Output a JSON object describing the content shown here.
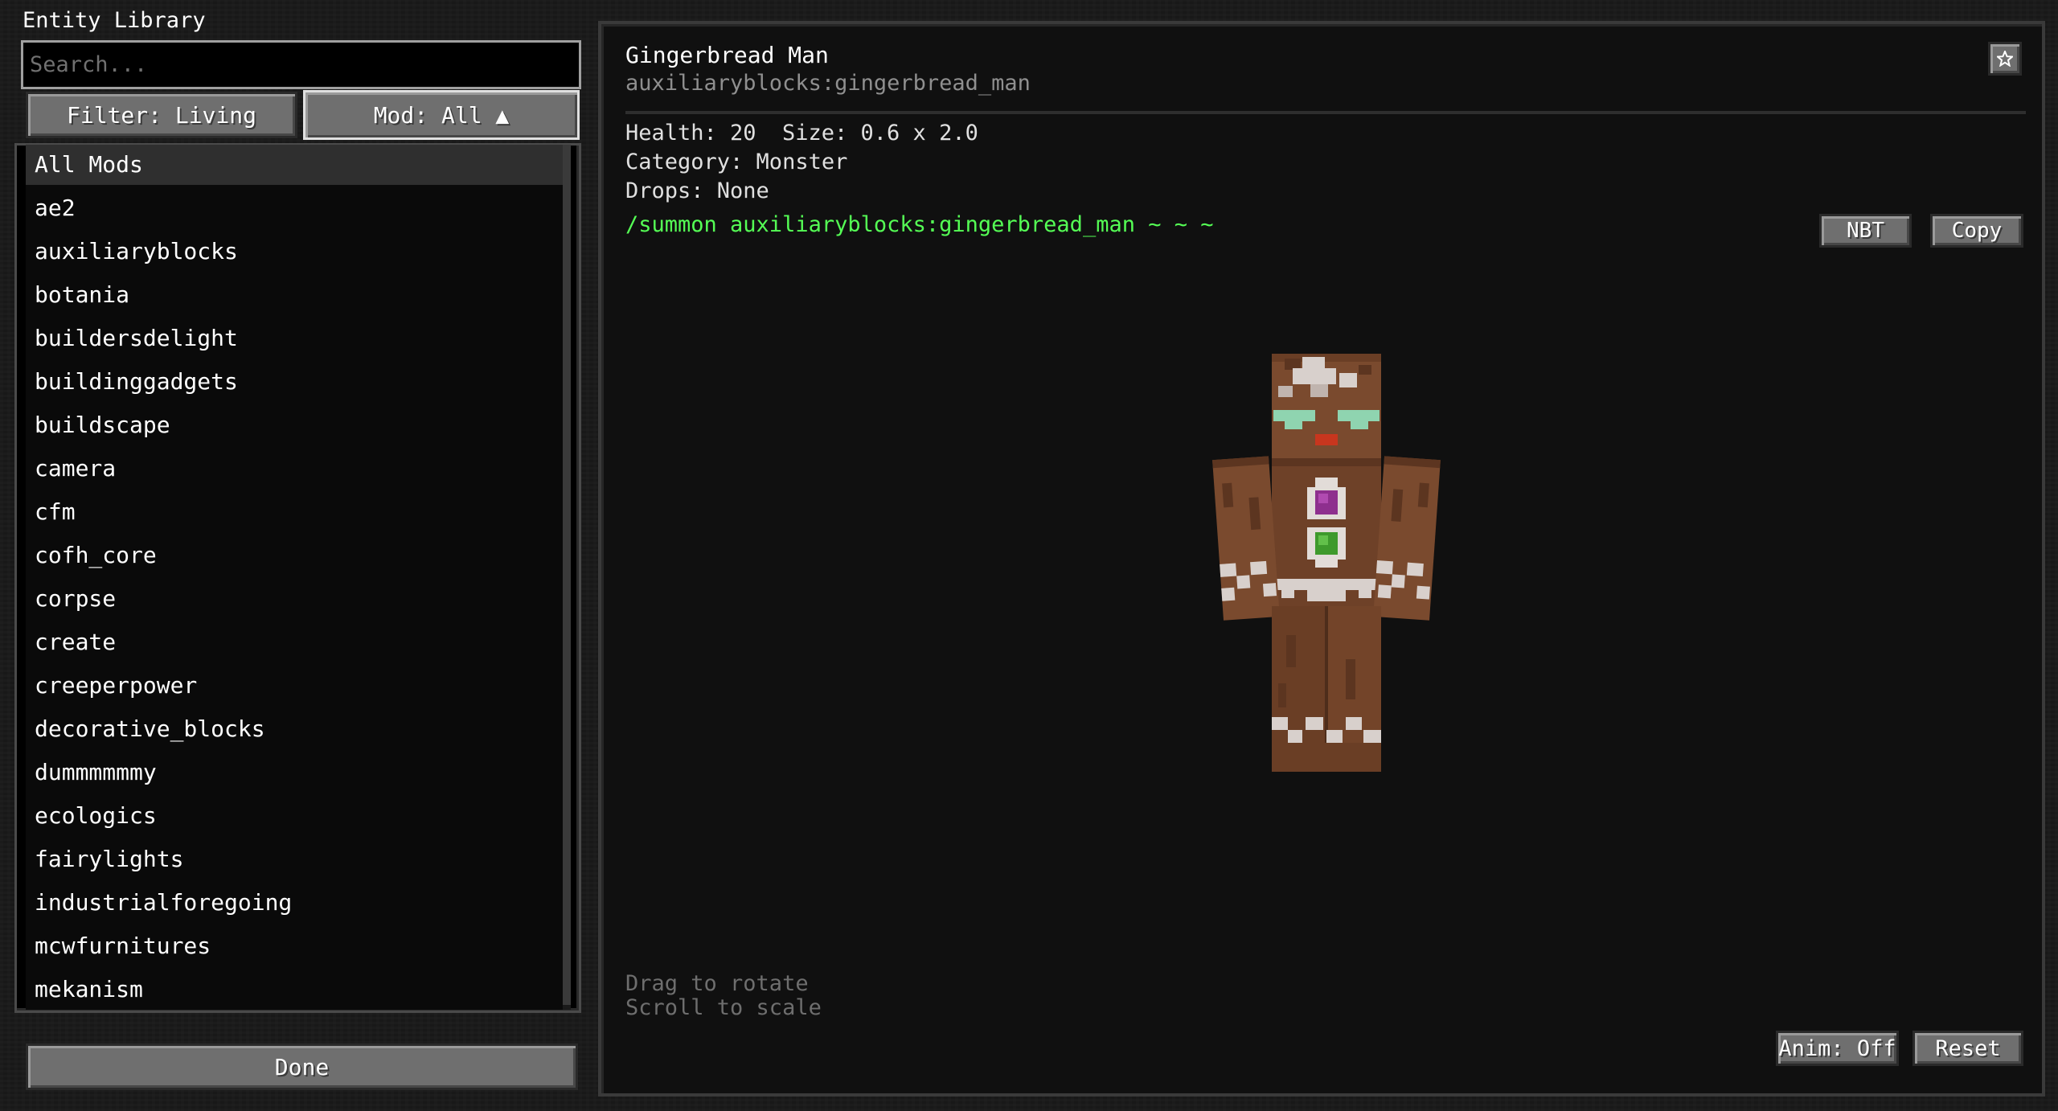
{
  "left_panel": {
    "title": "Entity Library",
    "search": {
      "placeholder": "Search...",
      "value": ""
    },
    "filter_button": "Filter: Living",
    "mod_button": "Mod: All ▲",
    "mod_list": [
      "All Mods",
      "ae2",
      "auxiliaryblocks",
      "botania",
      "buildersdelight",
      "buildinggadgets",
      "buildscape",
      "camera",
      "cfm",
      "cofh_core",
      "corpse",
      "create",
      "creeperpower",
      "decorative_blocks",
      "dummmmmmy",
      "ecologics",
      "fairylights",
      "industrialforegoing",
      "mcwfurnitures",
      "mekanism"
    ],
    "selected_index": 0,
    "done_button": "Done"
  },
  "entity": {
    "name": "Gingerbread Man",
    "id": "auxiliaryblocks:gingerbread_man",
    "health": "Health: 20",
    "size": "Size: 0.6 x 2.0",
    "category": "Category: Monster",
    "drops": "Drops: None",
    "summon_command": "/summon auxiliaryblocks:gingerbread_man ~ ~ ~",
    "favorite_icon": "star-icon"
  },
  "toolbar": {
    "nbt_label": "NBT",
    "copy_label": "Copy",
    "anim_label": "Anim: Off",
    "reset_label": "Reset"
  },
  "viewport": {
    "hint_rotate": "Drag to rotate",
    "hint_scale": "Scroll to scale"
  },
  "colors": {
    "command_green": "#55ff55",
    "button_gray": "#6f6f6f",
    "panel_bg": "#101010",
    "id_gray": "#8f8f8f"
  }
}
